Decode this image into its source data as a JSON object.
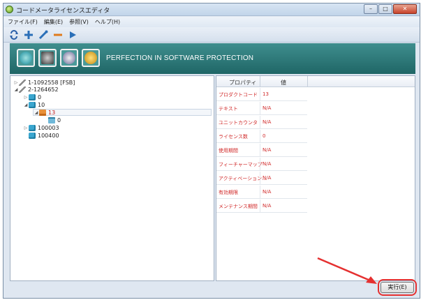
{
  "window": {
    "title": "コードメータライセンスエディタ"
  },
  "menu": [
    "ファイル(F)",
    "編集(E)",
    "参照(V)",
    "ヘルプ(H)"
  ],
  "toolbar": {
    "icons": [
      "refresh-icon",
      "add-icon",
      "edit-icon",
      "remove-icon",
      "run-icon"
    ]
  },
  "banner": {
    "tagline": "PERFECTION IN SOFTWARE PROTECTION"
  },
  "tree": [
    {
      "label": "1-1092558 [FSB]",
      "depth": 0,
      "state": "collapsed",
      "icon": "pencil-icon"
    },
    {
      "label": "2-1264652",
      "depth": 0,
      "state": "expanded",
      "icon": "pencil-icon"
    },
    {
      "label": "0",
      "depth": 1,
      "state": "collapsed",
      "icon": "cube-icon"
    },
    {
      "label": "10",
      "depth": 1,
      "state": "expanded",
      "icon": "cube-icon"
    },
    {
      "label": "13",
      "depth": 2,
      "state": "expanded",
      "icon": "folder-icon",
      "selected": true
    },
    {
      "label": "0",
      "depth": 3,
      "state": "leaf",
      "icon": "document-icon"
    },
    {
      "label": "100003",
      "depth": 1,
      "state": "collapsed",
      "icon": "cube-icon"
    },
    {
      "label": "100400",
      "depth": 1,
      "state": "leaf",
      "icon": "cube-icon"
    }
  ],
  "properties": {
    "columns": [
      "プロパティ",
      "値"
    ],
    "rows": [
      {
        "name": "プロダクトコード",
        "value": "13"
      },
      {
        "name": "テキスト",
        "value": "N/A"
      },
      {
        "name": "ユニットカウンタ",
        "value": "N/A"
      },
      {
        "name": "ライセンス数",
        "value": "0"
      },
      {
        "name": "使用期間",
        "value": "N/A"
      },
      {
        "name": "フィーチャーマップ",
        "value": "N/A"
      },
      {
        "name": "アクティベーション...",
        "value": "N/A"
      },
      {
        "name": "有効期限",
        "value": "N/A"
      },
      {
        "name": "メンテナンス期間",
        "value": "N/A"
      }
    ]
  },
  "execute_label": "実行(E)",
  "colors": {
    "banner": "#2e7c7c",
    "highlight": "#e53030",
    "property_text": "#d02a2a"
  }
}
